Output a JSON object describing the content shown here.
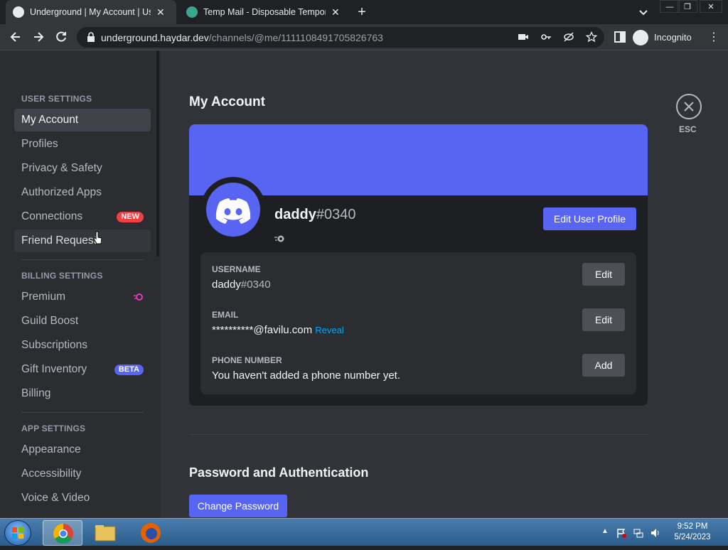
{
  "browser": {
    "tabs": [
      {
        "title": "Underground | My Account | User Settings",
        "active": true
      },
      {
        "title": "Temp Mail - Disposable Temporary Email",
        "active": false
      }
    ],
    "url_host": "underground.haydar.dev",
    "url_path": "/channels/@me/1111108491705826763",
    "profile_label": "Incognito"
  },
  "sidebar": {
    "user_settings_header": "USER SETTINGS",
    "user_items": [
      {
        "label": "My Account"
      },
      {
        "label": "Profiles"
      },
      {
        "label": "Privacy & Safety"
      },
      {
        "label": "Authorized Apps"
      },
      {
        "label": "Connections",
        "badge": "NEW"
      },
      {
        "label": "Friend Requests"
      }
    ],
    "billing_header": "BILLING SETTINGS",
    "billing_items": [
      {
        "label": "Premium"
      },
      {
        "label": "Guild Boost"
      },
      {
        "label": "Subscriptions"
      },
      {
        "label": "Gift Inventory",
        "badge": "BETA"
      },
      {
        "label": "Billing"
      }
    ],
    "app_header": "APP SETTINGS",
    "app_items": [
      {
        "label": "Appearance"
      },
      {
        "label": "Accessibility"
      },
      {
        "label": "Voice & Video"
      }
    ]
  },
  "account": {
    "title": "My Account",
    "display_name": "daddy",
    "discriminator": "#0340",
    "edit_profile_label": "Edit User Profile",
    "fields": {
      "username_label": "USERNAME",
      "username_name": "daddy",
      "username_disc": "#0340",
      "email_label": "EMAIL",
      "email_value": "**********@favilu.com",
      "reveal_label": "Reveal",
      "phone_label": "PHONE NUMBER",
      "phone_value": "You haven't added a phone number yet.",
      "edit_label": "Edit",
      "add_label": "Add"
    },
    "password_section_title": "Password and Authentication",
    "change_password_label": "Change Password",
    "esc_label": "ESC"
  },
  "taskbar": {
    "time": "9:52 PM",
    "date": "5/24/2023"
  },
  "colors": {
    "blurple": "#5865f2",
    "new_badge": "#f23f43",
    "beta_badge": "#5865f2",
    "link": "#00a8fc"
  }
}
